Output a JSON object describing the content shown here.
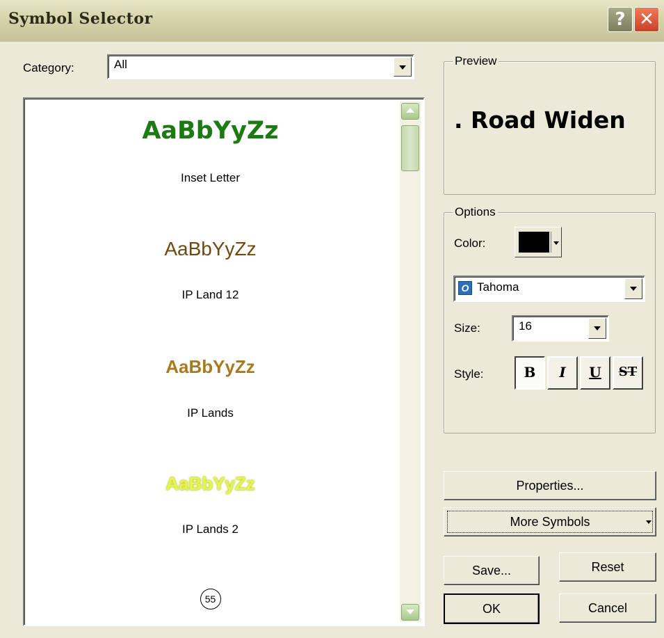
{
  "window": {
    "title": "Symbol Selector",
    "help_glyph": "?",
    "close_glyph": "✕"
  },
  "category": {
    "label": "Category:",
    "value": "All"
  },
  "symbols": [
    {
      "sample": "AaBbYyZz",
      "name": "Inset Letter",
      "color": "#1d7a12"
    },
    {
      "sample": "AaBbYyZz",
      "name": "IP Land 12",
      "color": "#6e4a12"
    },
    {
      "sample": "AaBbYyZz",
      "name": "IP Lands",
      "color": "#a87a1e"
    },
    {
      "sample": "AaBbYyZz",
      "name": "IP Lands 2",
      "color": "#dff03a"
    },
    {
      "sample": "55"
    }
  ],
  "preview": {
    "title": "Preview",
    "text": ". Road Widen"
  },
  "options": {
    "title": "Options",
    "color_label": "Color:",
    "color_value": "#000000",
    "font": "Tahoma",
    "size_label": "Size:",
    "size_value": "16",
    "style_label": "Style:",
    "bold": "B",
    "italic": "I",
    "underline": "U",
    "strike": "ST"
  },
  "buttons": {
    "properties": "Properties...",
    "more_symbols": "More Symbols",
    "save": "Save...",
    "reset": "Reset",
    "ok": "OK",
    "cancel": "Cancel"
  }
}
